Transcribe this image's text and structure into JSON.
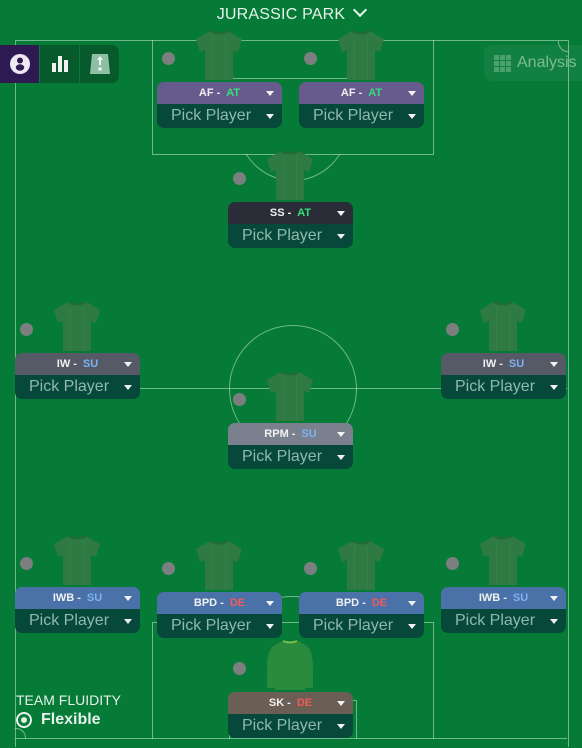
{
  "header": {
    "title": "JURASSIC PARK",
    "dropdown_icon": "chevron-down-icon"
  },
  "toolbar": {
    "buttons": [
      {
        "name": "player-view",
        "icon": "person-icon",
        "active": true
      },
      {
        "name": "stats-view",
        "icon": "bar-chart-icon",
        "active": false
      },
      {
        "name": "instructions-view",
        "icon": "tactic-board-icon",
        "active": false
      }
    ]
  },
  "analysis": {
    "label": "Analysis",
    "icon": "grid-icon"
  },
  "colors": {
    "pitch": "#067a37",
    "attack_duty": "#33e07a",
    "support_duty": "#7fb2f0",
    "defend_duty": "#f05a5a",
    "role_purple": "#675a8c",
    "role_dark": "#2a2d38",
    "role_gray": "#555a66",
    "role_lightgray": "#7a808e",
    "role_blue": "#4a72a8",
    "role_brown": "#6b5e55",
    "pick_bg": "#06493a"
  },
  "positions": [
    {
      "id": "af-left",
      "role": "AF",
      "duty": "AT",
      "pick": "Pick Player"
    },
    {
      "id": "af-right",
      "role": "AF",
      "duty": "AT",
      "pick": "Pick Player"
    },
    {
      "id": "ss",
      "role": "SS",
      "duty": "AT",
      "pick": "Pick Player"
    },
    {
      "id": "iw-left",
      "role": "IW",
      "duty": "SU",
      "pick": "Pick Player"
    },
    {
      "id": "iw-right",
      "role": "IW",
      "duty": "SU",
      "pick": "Pick Player"
    },
    {
      "id": "rpm",
      "role": "RPM",
      "duty": "SU",
      "pick": "Pick Player"
    },
    {
      "id": "iwb-left",
      "role": "IWB",
      "duty": "SU",
      "pick": "Pick Player"
    },
    {
      "id": "bpd-left",
      "role": "BPD",
      "duty": "DE",
      "pick": "Pick Player"
    },
    {
      "id": "bpd-right",
      "role": "BPD",
      "duty": "DE",
      "pick": "Pick Player"
    },
    {
      "id": "iwb-right",
      "role": "IWB",
      "duty": "SU",
      "pick": "Pick Player"
    },
    {
      "id": "sk",
      "role": "SK",
      "duty": "DE",
      "pick": "Pick Player"
    }
  ],
  "team_fluidity": {
    "label": "TEAM FLUIDITY",
    "value": "Flexible"
  }
}
